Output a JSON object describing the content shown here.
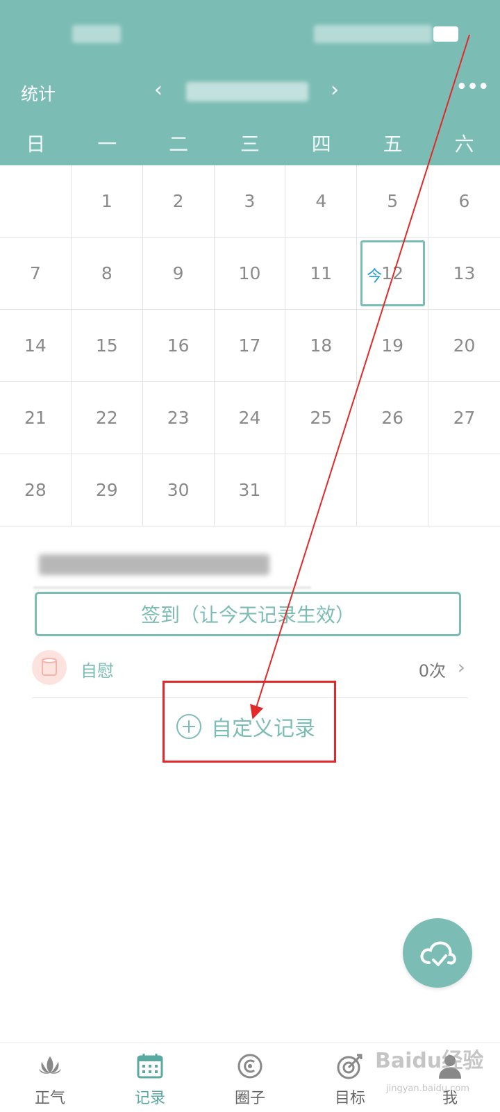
{
  "header": {
    "stats_label": "统计",
    "prev_symbol": "‹",
    "next_symbol": "›",
    "more_symbol": "•••",
    "weekdays": [
      "日",
      "一",
      "二",
      "三",
      "四",
      "五",
      "六"
    ]
  },
  "calendar": {
    "rows": [
      [
        "",
        "1",
        "2",
        "3",
        "4",
        "5",
        "6"
      ],
      [
        "7",
        "8",
        "9",
        "10",
        "11",
        "12",
        "13"
      ],
      [
        "14",
        "15",
        "16",
        "17",
        "18",
        "19",
        "20"
      ],
      [
        "21",
        "22",
        "23",
        "24",
        "25",
        "26",
        "27"
      ],
      [
        "28",
        "29",
        "30",
        "31",
        "",
        "",
        ""
      ]
    ],
    "today_mark": "今",
    "today_date": "12"
  },
  "detail": {
    "checkin_label": "签到（让今天记录生效）",
    "record_name": "自慰",
    "record_count": "0次",
    "custom_record_label": "自定义记录"
  },
  "tabbar": {
    "items": [
      {
        "label": "正气",
        "icon": "lotus-icon"
      },
      {
        "label": "记录",
        "icon": "calendar-icon"
      },
      {
        "label": "圈子",
        "icon": "circle-icon"
      },
      {
        "label": "目标",
        "icon": "target-icon"
      },
      {
        "label": "我",
        "icon": "person-icon"
      }
    ]
  },
  "watermark": {
    "main": "Baidu经验",
    "sub": "jingyan.baidu.com"
  },
  "colors": {
    "accent": "#7bbdb5",
    "today": "#1e9ad6",
    "annotation": "#e22828"
  }
}
